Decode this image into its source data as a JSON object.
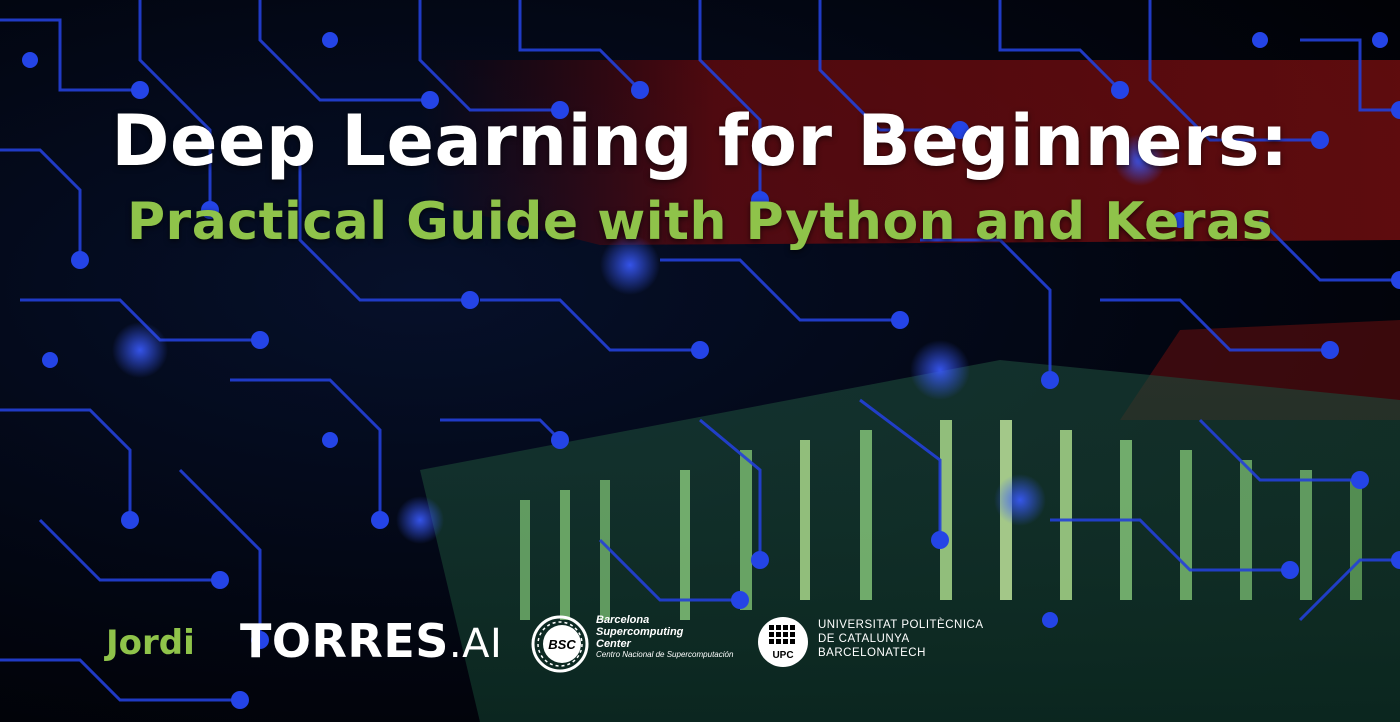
{
  "title": "Deep Learning for Beginners:",
  "subtitle": "Practical Guide with Python and Keras",
  "author": {
    "first_name": "Jordi",
    "brand_main": "TORRES",
    "brand_suffix": ".AI"
  },
  "bsc": {
    "abbrev": "BSC",
    "line1": "Barcelona",
    "line2": "Supercomputing",
    "line3": "Center",
    "line4": "Centro Nacional de Supercomputación"
  },
  "upc": {
    "abbrev": "UPC",
    "line1": "UNIVERSITAT POLITÈCNICA",
    "line2": "DE CATALUNYA",
    "line3": "BARCELONATECH"
  },
  "colors": {
    "accent_green": "#8fc34a",
    "circuit_blue": "#1f3fd6",
    "title_white": "#ffffff"
  },
  "background": "circuit-board-illustration"
}
